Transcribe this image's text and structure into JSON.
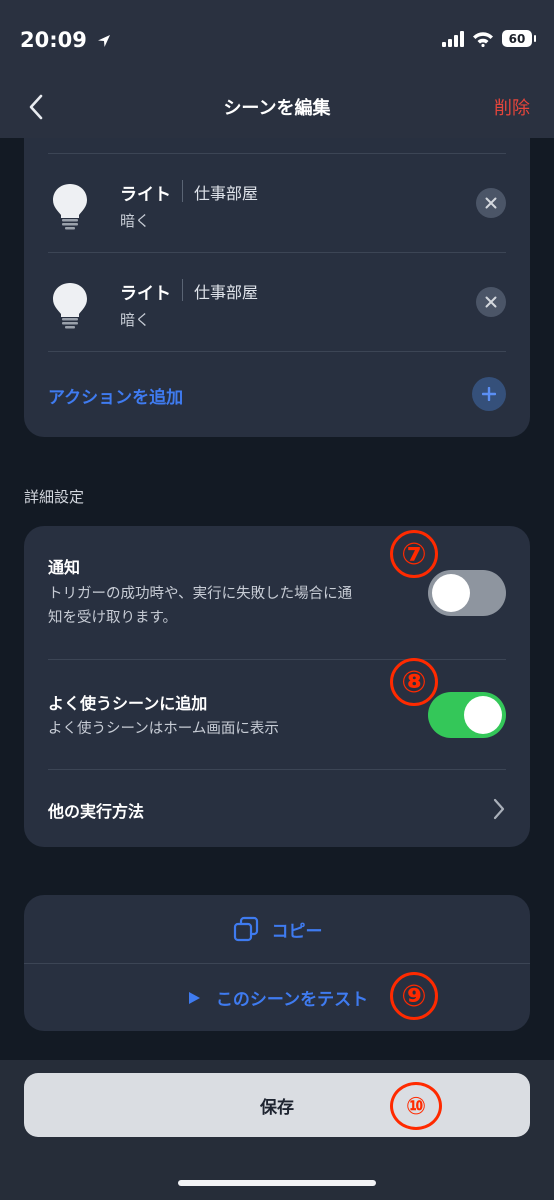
{
  "status_bar": {
    "time": "20:09",
    "battery": "60"
  },
  "header": {
    "title": "シーンを編集",
    "delete_label": "削除"
  },
  "actions": [
    {
      "device": "ライト",
      "room": "仕事部屋",
      "state": "暗く"
    },
    {
      "device": "ライト",
      "room": "仕事部屋",
      "state": "暗く"
    }
  ],
  "add_action_label": "アクションを追加",
  "advanced": {
    "section_label": "詳細設定",
    "notification": {
      "title": "通知",
      "desc_line1": "トリガーの成功時や、実行に失敗した場合に通",
      "desc_line2": "知を受け取ります。",
      "enabled": false
    },
    "favorite": {
      "title": "よく使うシーンに追加",
      "desc": "よく使うシーンはホーム画面に表示",
      "enabled": true
    },
    "other_methods": {
      "title": "他の実行方法"
    }
  },
  "buttons": {
    "copy": "コピー",
    "test": "このシーンをテスト",
    "save": "保存"
  },
  "annotations": {
    "a7": "⑦",
    "a8": "⑧",
    "a9": "⑨",
    "a10": "⑩"
  },
  "colors": {
    "accent": "#3f7bf0",
    "delete": "#e5453b",
    "toggle_on": "#34c759",
    "toggle_off": "#8e959f",
    "annotation": "#ff2a00"
  }
}
